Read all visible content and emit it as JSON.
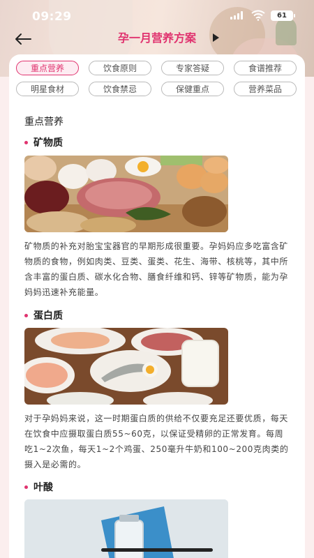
{
  "status": {
    "time": "09:29",
    "battery": "61"
  },
  "nav": {
    "title": "孕一月营养方案"
  },
  "tabs": [
    {
      "label": "重点营养",
      "active": true
    },
    {
      "label": "饮食原则",
      "active": false
    },
    {
      "label": "专家答疑",
      "active": false
    },
    {
      "label": "食谱推荐",
      "active": false
    },
    {
      "label": "明星食材",
      "active": false
    },
    {
      "label": "饮食禁忌",
      "active": false
    },
    {
      "label": "保健重点",
      "active": false
    },
    {
      "label": "营养菜品",
      "active": false
    }
  ],
  "content": {
    "section_title": "重点营养",
    "items": [
      {
        "heading": "矿物质",
        "text": "矿物质的补充对胎宝宝器官的早期形成很重要。孕妈妈应多吃富含矿物质的食物，例如肉类、豆类、蛋类、花生、海带、核桃等，其中所含丰富的蛋白质、碳水化合物、膳食纤维和钙、锌等矿物质，能为孕妈妈迅速补充能量。"
      },
      {
        "heading": "蛋白质",
        "text": "对于孕妈妈来说，这一时期蛋白质的供给不仅要充足还要优质，每天在饮食中应摄取蛋白质55~60克，以保证受精卵的正常发育。每周吃1~2次鱼，每天1~2个鸡蛋、250毫升牛奶和100~200克肉类的摄入是必需的。"
      },
      {
        "heading": "叶酸",
        "text": ""
      }
    ]
  },
  "colors": {
    "accent": "#e0336f",
    "background": "#fbeeee",
    "card": "#ffffff"
  }
}
